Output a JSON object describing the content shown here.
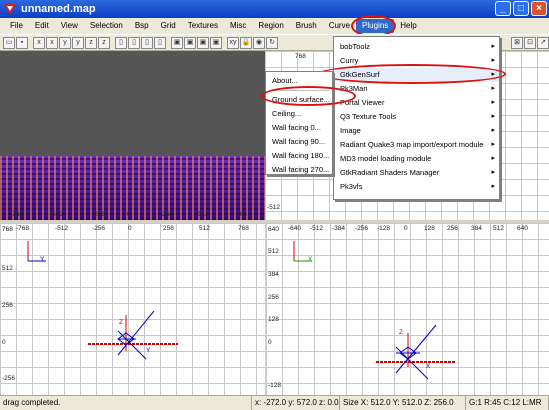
{
  "window": {
    "title": "unnamed.map"
  },
  "menus": [
    "File",
    "Edit",
    "View",
    "Selection",
    "Bsp",
    "Grid",
    "Textures",
    "Misc",
    "Region",
    "Brush",
    "Curve",
    "Plugins",
    "Help"
  ],
  "plugins_menu": {
    "items": [
      {
        "label": "bobToolz"
      },
      {
        "label": "Curry"
      },
      {
        "label": "GtkGenSurf"
      },
      {
        "label": "Pk3Man"
      },
      {
        "label": "Portal Viewer"
      },
      {
        "label": "Q3 Texture Tools"
      },
      {
        "label": "Image"
      },
      {
        "label": "Radiant Quake3 map import/export module"
      },
      {
        "label": "MD3 model loading module"
      },
      {
        "label": "GtkRadiant Shaders Manager"
      },
      {
        "label": "Pk3vfs"
      }
    ]
  },
  "gensurf_submenu": {
    "items": [
      "About...",
      "Ground surface...",
      "Ceiling...",
      "Wall facing 0...",
      "Wall facing 90...",
      "Wall facing 180...",
      "Wall facing 270..."
    ]
  },
  "views": {
    "top_ruler": [
      "-768",
      "-512",
      "-256",
      "0",
      "256",
      "512",
      "768"
    ],
    "top_right_ruler": [
      "768"
    ],
    "top_left_value": "-512",
    "xz_ruler_x": [
      "-768",
      "-512",
      "-256",
      "0",
      "256",
      "512",
      "768"
    ],
    "xz_ruler_y": [
      "768",
      "512",
      "256",
      "0",
      "-256"
    ],
    "xz_axis": {
      "h": "X",
      "v": "Y"
    },
    "yz_ruler_x": [
      "-640",
      "-512",
      "-384",
      "-256",
      "-128",
      "0",
      "128",
      "256",
      "384",
      "512",
      "640"
    ],
    "yz_ruler_y": [
      "640",
      "512",
      "384",
      "256",
      "128",
      "0",
      "-128"
    ],
    "yz_axis": {
      "h": "X",
      "v": "Z"
    },
    "gizmo": {
      "z": "Z",
      "x": "X",
      "y": "Y"
    }
  },
  "status": {
    "message": "drag completed.",
    "coords": "x: -272.0  y: 572.0  z: 0.0",
    "size": "Size X: 512.0  Y: 512.0  Z: 256.0",
    "grid": "G:1 R:45 C:12 L:MR"
  },
  "colors": {
    "highlight": "#e01010",
    "titlebar": "#0a3fc4",
    "axis_red": "#d00000",
    "axis_blue": "#0000c0",
    "axis_green": "#00a000"
  }
}
